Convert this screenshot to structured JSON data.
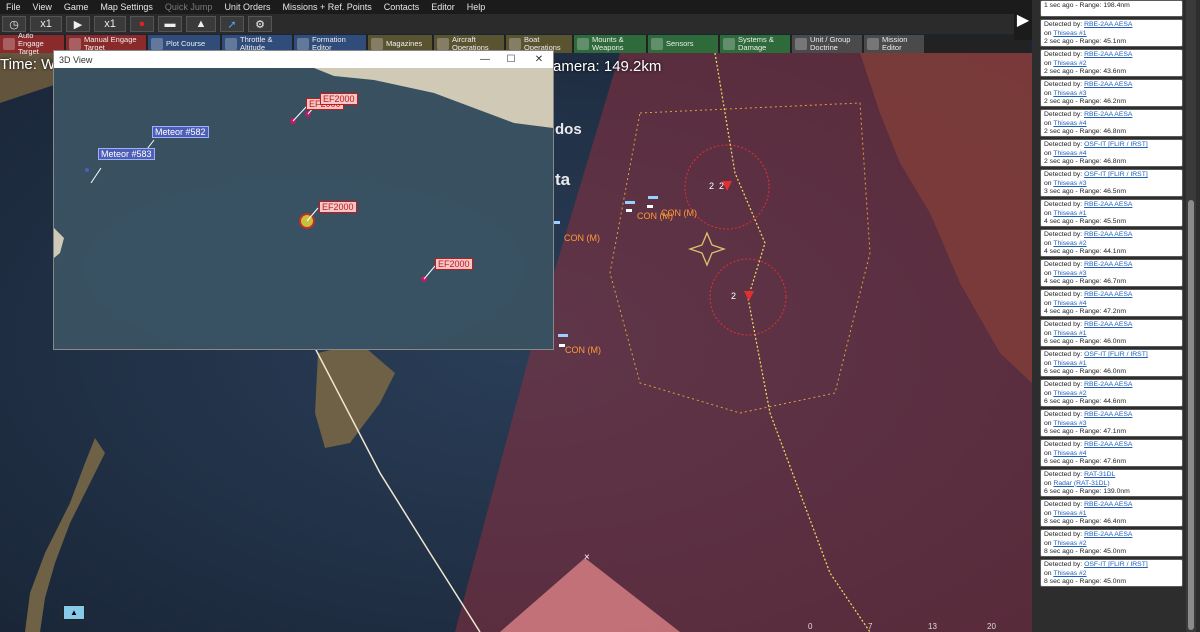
{
  "menu": [
    "File",
    "View",
    "Game",
    "Map Settings",
    "Quick Jump",
    "Unit Orders",
    "Missions + Ref. Points",
    "Contacts",
    "Editor",
    "Help"
  ],
  "toolbar1": {
    "speed1": "x1",
    "speed2": "x1"
  },
  "actions": [
    {
      "label": "Auto Engage Target",
      "color": "#8a2a2a"
    },
    {
      "label": "Manual Engage Target",
      "color": "#8a2a2a"
    },
    {
      "label": "Plot Course",
      "color": "#2f4c7a"
    },
    {
      "label": "Throttle & Altitude",
      "color": "#2f4c7a"
    },
    {
      "label": "Formation Editor",
      "color": "#2f4c7a"
    },
    {
      "label": "Magazines",
      "color": "#5a5330"
    },
    {
      "label": "Aircraft Operations",
      "color": "#5a5330"
    },
    {
      "label": "Boat Operations",
      "color": "#5a5330"
    },
    {
      "label": "Mounts & Weapons",
      "color": "#2e6a3a"
    },
    {
      "label": "Sensors",
      "color": "#2e6a3a"
    },
    {
      "label": "Systems & Damage",
      "color": "#2e6a3a"
    },
    {
      "label": "Unit / Group Doctrine",
      "color": "#4a4a4a"
    },
    {
      "label": "Mission Editor",
      "color": "#4a4a4a"
    }
  ],
  "timebar": "Time: We",
  "camera": "amera: 149.2km",
  "window3d": {
    "title": "3D View",
    "labels": [
      "Meteor #582",
      "Meteor #583",
      "EF2000",
      "EF2000",
      "EF2000",
      "EF2000"
    ]
  },
  "map_labels": {
    "con1": "CON (M)",
    "con2": "CON (M)",
    "con3": "CON (M)",
    "con4": "CON (M)",
    "group1": "2",
    "group2": "2",
    "group3": "2",
    "place1": "dos",
    "place2": "ta"
  },
  "scale_ticks": [
    "0",
    "7",
    "13",
    "20"
  ],
  "detections": [
    {
      "sensor": "",
      "unit": "",
      "time": "1 sec ago",
      "range": "Range: 198.4nm"
    },
    {
      "sensor": "RBE-2AA AESA",
      "unit": "Thiseas #1",
      "time": "2 sec ago",
      "range": "Range: 45.1nm"
    },
    {
      "sensor": "RBE-2AA AESA",
      "unit": "Thiseas #2",
      "time": "2 sec ago",
      "range": "Range: 43.6nm"
    },
    {
      "sensor": "RBE-2AA AESA",
      "unit": "Thiseas #3",
      "time": "2 sec ago",
      "range": "Range: 46.2nm"
    },
    {
      "sensor": "RBE-2AA AESA",
      "unit": "Thiseas #4",
      "time": "2 sec ago",
      "range": "Range: 46.8nm"
    },
    {
      "sensor": "OSF-IT [FLIR / IRST]",
      "unit": "Thiseas #4",
      "time": "2 sec ago",
      "range": "Range: 46.8nm"
    },
    {
      "sensor": "OSF-IT [FLIR / IRST]",
      "unit": "Thiseas #3",
      "time": "3 sec ago",
      "range": "Range: 46.5nm"
    },
    {
      "sensor": "RBE-2AA AESA",
      "unit": "Thiseas #1",
      "time": "4 sec ago",
      "range": "Range: 45.5nm"
    },
    {
      "sensor": "RBE-2AA AESA",
      "unit": "Thiseas #2",
      "time": "4 sec ago",
      "range": "Range: 44.1nm"
    },
    {
      "sensor": "RBE-2AA AESA",
      "unit": "Thiseas #3",
      "time": "4 sec ago",
      "range": "Range: 46.7nm"
    },
    {
      "sensor": "RBE-2AA AESA",
      "unit": "Thiseas #4",
      "time": "4 sec ago",
      "range": "Range: 47.2nm"
    },
    {
      "sensor": "RBE-2AA AESA",
      "unit": "Thiseas #1",
      "time": "6 sec ago",
      "range": "Range: 46.0nm"
    },
    {
      "sensor": "OSF-IT [FLIR / IRST]",
      "unit": "Thiseas #1",
      "time": "6 sec ago",
      "range": "Range: 46.0nm"
    },
    {
      "sensor": "RBE-2AA AESA",
      "unit": "Thiseas #2",
      "time": "6 sec ago",
      "range": "Range: 44.6nm"
    },
    {
      "sensor": "RBE-2AA AESA",
      "unit": "Thiseas #3",
      "time": "6 sec ago",
      "range": "Range: 47.1nm"
    },
    {
      "sensor": "RBE-2AA AESA",
      "unit": "Thiseas #4",
      "time": "6 sec ago",
      "range": "Range: 47.6nm"
    },
    {
      "sensor": "RAT-31DL",
      "unit": "Radar (RAT-31DL)",
      "time": "6 sec ago",
      "range": "Range: 139.0nm"
    },
    {
      "sensor": "RBE-2AA AESA",
      "unit": "Thiseas #1",
      "time": "8 sec ago",
      "range": "Range: 46.4nm"
    },
    {
      "sensor": "RBE-2AA AESA",
      "unit": "Thiseas #2",
      "time": "8 sec ago",
      "range": "Range: 45.0nm"
    },
    {
      "sensor": "OSF-IT [FLIR / IRST]",
      "unit": "Thiseas #2",
      "time": "8 sec ago",
      "range": "Range: 45.0nm"
    }
  ],
  "strings": {
    "detected_by": "Detected by:",
    "on": "on",
    "sep": " - "
  }
}
